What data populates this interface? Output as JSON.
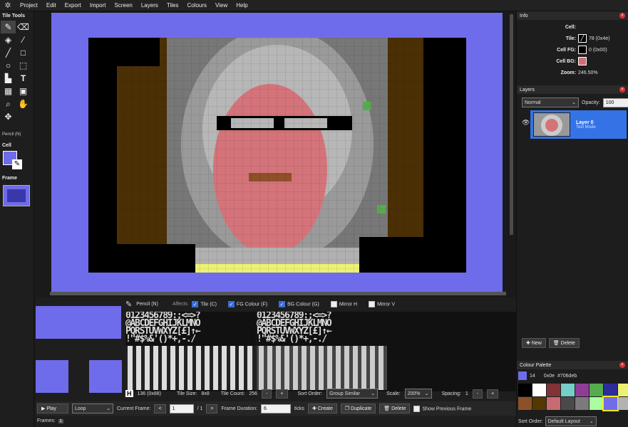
{
  "menu": [
    "Project",
    "Edit",
    "Export",
    "Import",
    "Screen",
    "Layers",
    "Tiles",
    "Colours",
    "View",
    "Help"
  ],
  "tools": {
    "title": "Tile Tools",
    "current_tool": "Pencil (N)",
    "cell_label": "Cell",
    "frame_label": "Frame",
    "items": [
      "pencil-icon",
      "eraser-icon",
      "fill-icon",
      "eyedropper-icon",
      "line-icon",
      "rect-icon",
      "circle-icon",
      "select-icon",
      "stamp-icon",
      "text-icon",
      "grid-icon",
      "block-icon",
      "zoom-icon",
      "hand-icon",
      "move-icon"
    ]
  },
  "colors": {
    "accent": "#6f6ceb",
    "layer_selected": "#3473e6"
  },
  "info": {
    "title": "Info",
    "cell_label": "Cell:",
    "tile_label": "Tile:",
    "tile_value": "78 (0x4e)",
    "fg_label": "Cell FG:",
    "fg_value": "0 (0x00)",
    "fg_color": "#000000",
    "bg_label": "Cell BG:",
    "bg_color": "#d26e72",
    "zoom_label": "Zoom:",
    "zoom_value": "246.50%"
  },
  "layers": {
    "title": "Layers",
    "blend_mode": "Normal",
    "opacity_label": "Opacity:",
    "opacity_value": "100",
    "layer_name": "Layer 0",
    "layer_mode": "Text Mode",
    "new_label": "New",
    "delete_label": "Delete"
  },
  "palette": {
    "title": "Colour Palette",
    "selected_index": "14",
    "selected_hex": "0x0e",
    "selected_code": "#706deb",
    "sort_label": "Sort Order:",
    "sort_value": "Default Layout",
    "colors": [
      "#000000",
      "#ffffff",
      "#813338",
      "#75cec8",
      "#8e3c97",
      "#56ac4d",
      "#2e2c9b",
      "#edf171",
      "#8e5029",
      "#553800",
      "#c46c71",
      "#4a4a4a",
      "#7b7b7b",
      "#a9ff9f",
      "#706deb",
      "#b2b2b2"
    ]
  },
  "tiles": {
    "pencil_label": "Pencil (N)",
    "affects_label": "Affects",
    "tile_cb": "Tile (C)",
    "fg_cb": "FG Colour (F)",
    "bg_cb": "BG Colour (G)",
    "mirror_h": "Mirror H",
    "mirror_v": "Mirror V",
    "charset_rows": [
      "@ABCDEFGHIJKLMNO",
      "PQRSTUVWXYZ[£]↑←",
      " !\"#$%&'()*+,-./",
      "0123456789:;<=>?"
    ],
    "char_preview": "H",
    "char_code": "136 (0x88)",
    "tile_size_label": "Tile Size:",
    "tile_size": "8x8",
    "tile_count_label": "Tile Count:",
    "tile_count": "256",
    "sort_label": "Sort Order:",
    "sort_value": "Group Similar",
    "scale_label": "Scale:",
    "scale_value": "200%",
    "spacing_label": "Spacing:",
    "spacing_value": "1"
  },
  "frames": {
    "play_label": "Play",
    "loop_value": "Loop",
    "current_label": "Current Frame:",
    "current_value": "1",
    "total": "/ 1",
    "duration_label": "Frame Duration:",
    "duration_value": "6",
    "ticks_label": "ticks",
    "create_label": "Create",
    "duplicate_label": "Duplicate",
    "delete_label": "Delete",
    "show_prev_label": "Show Previous Frame",
    "frames_label": "Frames:",
    "frames_count": "1"
  }
}
